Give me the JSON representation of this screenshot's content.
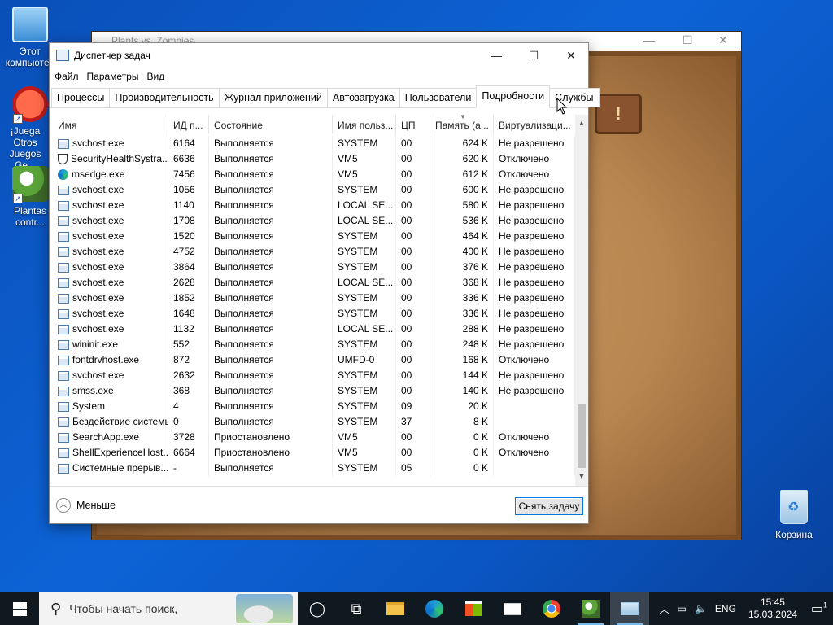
{
  "desktop": {
    "icons": [
      {
        "label": "Этот компьютер"
      },
      {
        "label": "¡Juega Otros Juegos Ge..."
      },
      {
        "label": "Plantas contr..."
      }
    ],
    "recycle_bin": "Корзина"
  },
  "pvz_window": {
    "title": "Plants vs. Zombies",
    "sign_text": "!"
  },
  "task_manager": {
    "title": "Диспетчер задач",
    "menu": [
      "Файл",
      "Параметры",
      "Вид"
    ],
    "tabs": [
      "Процессы",
      "Производительность",
      "Журнал приложений",
      "Автозагрузка",
      "Пользователи",
      "Подробности",
      "Службы"
    ],
    "active_tab": "Подробности",
    "columns": [
      "Имя",
      "ИД п...",
      "Состояние",
      "Имя польз...",
      "ЦП",
      "Память (а...",
      "Виртуализаци..."
    ],
    "rows": [
      {
        "icon": "app",
        "name": "svchost.exe",
        "pid": "6164",
        "state": "Выполняется",
        "user": "SYSTEM",
        "cpu": "00",
        "mem": "624 K",
        "virt": "Не разрешено"
      },
      {
        "icon": "shield",
        "name": "SecurityHealthSystra...",
        "pid": "6636",
        "state": "Выполняется",
        "user": "VM5",
        "cpu": "00",
        "mem": "620 K",
        "virt": "Отключено"
      },
      {
        "icon": "edge",
        "name": "msedge.exe",
        "pid": "7456",
        "state": "Выполняется",
        "user": "VM5",
        "cpu": "00",
        "mem": "612 K",
        "virt": "Отключено"
      },
      {
        "icon": "app",
        "name": "svchost.exe",
        "pid": "1056",
        "state": "Выполняется",
        "user": "SYSTEM",
        "cpu": "00",
        "mem": "600 K",
        "virt": "Не разрешено"
      },
      {
        "icon": "app",
        "name": "svchost.exe",
        "pid": "1140",
        "state": "Выполняется",
        "user": "LOCAL SE...",
        "cpu": "00",
        "mem": "580 K",
        "virt": "Не разрешено"
      },
      {
        "icon": "app",
        "name": "svchost.exe",
        "pid": "1708",
        "state": "Выполняется",
        "user": "LOCAL SE...",
        "cpu": "00",
        "mem": "536 K",
        "virt": "Не разрешено"
      },
      {
        "icon": "app",
        "name": "svchost.exe",
        "pid": "1520",
        "state": "Выполняется",
        "user": "SYSTEM",
        "cpu": "00",
        "mem": "464 K",
        "virt": "Не разрешено"
      },
      {
        "icon": "app",
        "name": "svchost.exe",
        "pid": "4752",
        "state": "Выполняется",
        "user": "SYSTEM",
        "cpu": "00",
        "mem": "400 K",
        "virt": "Не разрешено"
      },
      {
        "icon": "app",
        "name": "svchost.exe",
        "pid": "3864",
        "state": "Выполняется",
        "user": "SYSTEM",
        "cpu": "00",
        "mem": "376 K",
        "virt": "Не разрешено"
      },
      {
        "icon": "app",
        "name": "svchost.exe",
        "pid": "2628",
        "state": "Выполняется",
        "user": "LOCAL SE...",
        "cpu": "00",
        "mem": "368 K",
        "virt": "Не разрешено"
      },
      {
        "icon": "app",
        "name": "svchost.exe",
        "pid": "1852",
        "state": "Выполняется",
        "user": "SYSTEM",
        "cpu": "00",
        "mem": "336 K",
        "virt": "Не разрешено"
      },
      {
        "icon": "app",
        "name": "svchost.exe",
        "pid": "1648",
        "state": "Выполняется",
        "user": "SYSTEM",
        "cpu": "00",
        "mem": "336 K",
        "virt": "Не разрешено"
      },
      {
        "icon": "app",
        "name": "svchost.exe",
        "pid": "1132",
        "state": "Выполняется",
        "user": "LOCAL SE...",
        "cpu": "00",
        "mem": "288 K",
        "virt": "Не разрешено"
      },
      {
        "icon": "app",
        "name": "wininit.exe",
        "pid": "552",
        "state": "Выполняется",
        "user": "SYSTEM",
        "cpu": "00",
        "mem": "248 K",
        "virt": "Не разрешено"
      },
      {
        "icon": "app",
        "name": "fontdrvhost.exe",
        "pid": "872",
        "state": "Выполняется",
        "user": "UMFD-0",
        "cpu": "00",
        "mem": "168 K",
        "virt": "Отключено"
      },
      {
        "icon": "app",
        "name": "svchost.exe",
        "pid": "2632",
        "state": "Выполняется",
        "user": "SYSTEM",
        "cpu": "00",
        "mem": "144 K",
        "virt": "Не разрешено"
      },
      {
        "icon": "app",
        "name": "smss.exe",
        "pid": "368",
        "state": "Выполняется",
        "user": "SYSTEM",
        "cpu": "00",
        "mem": "140 K",
        "virt": "Не разрешено"
      },
      {
        "icon": "app",
        "name": "System",
        "pid": "4",
        "state": "Выполняется",
        "user": "SYSTEM",
        "cpu": "09",
        "mem": "20 K",
        "virt": ""
      },
      {
        "icon": "app",
        "name": "Бездействие системы",
        "pid": "0",
        "state": "Выполняется",
        "user": "SYSTEM",
        "cpu": "37",
        "mem": "8 K",
        "virt": ""
      },
      {
        "icon": "app",
        "name": "SearchApp.exe",
        "pid": "3728",
        "state": "Приостановлено",
        "user": "VM5",
        "cpu": "00",
        "mem": "0 K",
        "virt": "Отключено"
      },
      {
        "icon": "app",
        "name": "ShellExperienceHost....",
        "pid": "6664",
        "state": "Приостановлено",
        "user": "VM5",
        "cpu": "00",
        "mem": "0 K",
        "virt": "Отключено"
      },
      {
        "icon": "app",
        "name": "Системные прерыв...",
        "pid": "-",
        "state": "Выполняется",
        "user": "SYSTEM",
        "cpu": "05",
        "mem": "0 K",
        "virt": ""
      }
    ],
    "fewer_label": "Меньше",
    "end_task_label": "Снять задачу"
  },
  "taskbar": {
    "search_placeholder": "Чтобы начать поиск,",
    "lang": "ENG",
    "time": "15:45",
    "date": "15.03.2024",
    "notification_count": "1"
  }
}
